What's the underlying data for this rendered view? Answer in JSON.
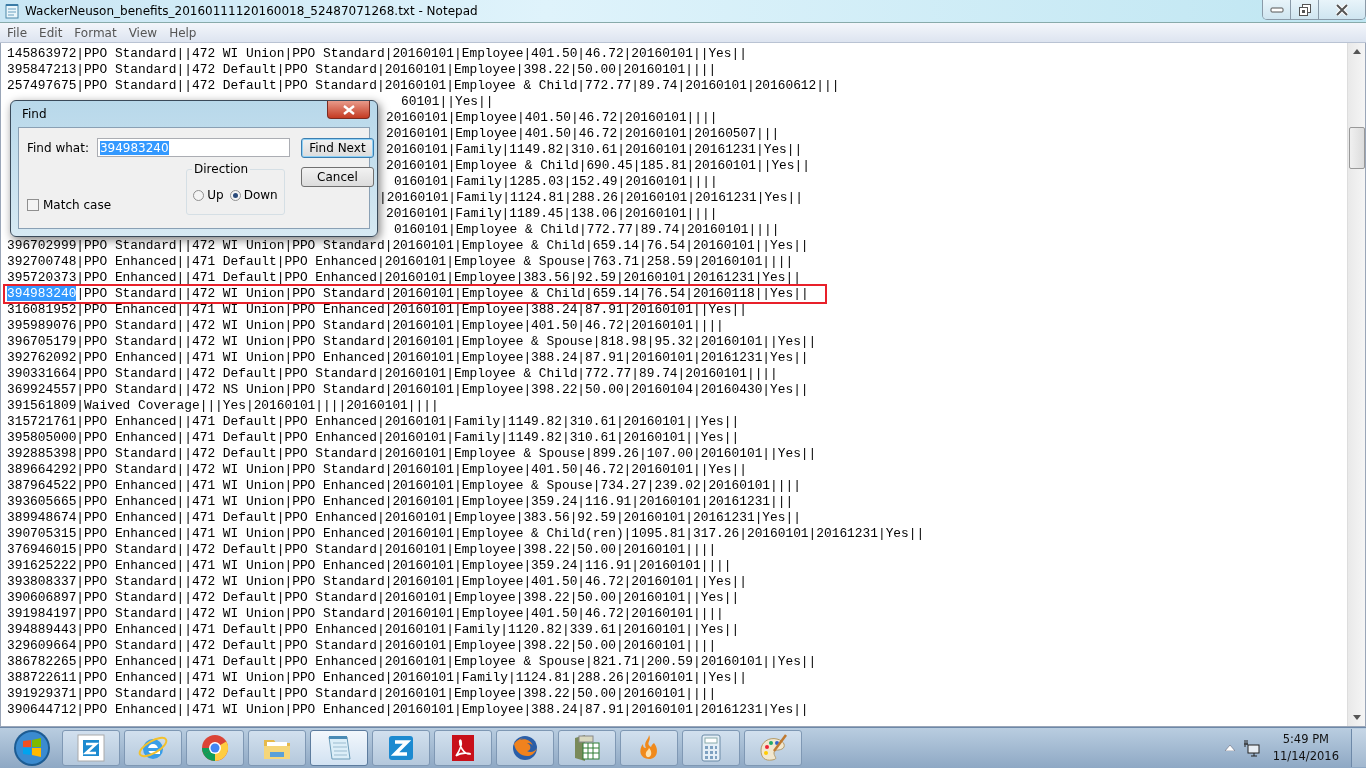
{
  "window": {
    "title": "WackerNeuson_benefits_20160111120160018_52487071268.txt - Notepad"
  },
  "menu": [
    "File",
    "Edit",
    "Format",
    "View",
    "Help"
  ],
  "lines": [
    {
      "kind": "plain",
      "text": "145863972|PPO Standard||472 WI Union|PPO Standard|20160101|Employee|401.50|46.72|20160101||Yes||"
    },
    {
      "kind": "plain",
      "text": "395847213|PPO Standard||472 Default|PPO Standard|20160101|Employee|398.22|50.00|20160101||||"
    },
    {
      "kind": "plain",
      "text": "257497675|PPO Standard||472 Default|PPO Standard|20160101|Employee & Child|772.77|89.74|20160101|20160612|||"
    },
    {
      "kind": "covered",
      "text": "60101||Yes||"
    },
    {
      "kind": "covered",
      "text": "20160101|Employee|401.50|46.72|20160101||||"
    },
    {
      "kind": "covered",
      "text": "20160101|Employee|401.50|46.72|20160101|20160507|||"
    },
    {
      "kind": "covered",
      "text": "20160101|Family|1149.82|310.61|20160101|20161231|Yes||"
    },
    {
      "kind": "covered",
      "text": "20160101|Employee & Child|690.45|185.81|20160101||Yes||"
    },
    {
      "kind": "covered",
      "text": "0160101|Family|1285.03|152.49|20160101||||"
    },
    {
      "kind": "covered",
      "text": "|20160101|Family|1124.81|288.26|20160101|20161231|Yes||"
    },
    {
      "kind": "covered",
      "text": "20160101|Family|1189.45|138.06|20160101||||"
    },
    {
      "kind": "covered",
      "text": "0160101|Employee & Child|772.77|89.74|20160101||||"
    },
    {
      "kind": "plain",
      "text": "396702999|PPO Standard||472 WI Union|PPO Standard|20160101|Employee & Child|659.14|76.54|20160101||Yes||"
    },
    {
      "kind": "plain",
      "text": "392700748|PPO Enhanced||471 Default|PPO Enhanced|20160101|Employee & Spouse|763.71|258.59|20160101||||"
    },
    {
      "kind": "plain",
      "text": "395720373|PPO Enhanced||471 Default|PPO Enhanced|20160101|Employee|383.56|92.59|20160101|20161231|Yes||"
    },
    {
      "kind": "selected",
      "selection": "394983240",
      "text": "|PPO Standard||472 WI Union|PPO Standard|20160101|Employee & Child|659.14|76.54|20160118||Yes||"
    },
    {
      "kind": "plain",
      "text": "316081952|PPO Enhanced||471 WI Union|PPO Enhanced|20160101|Employee|388.24|87.91|20160101||Yes||"
    },
    {
      "kind": "plain",
      "text": "395989076|PPO Standard||472 WI Union|PPO Standard|20160101|Employee|401.50|46.72|20160101||||"
    },
    {
      "kind": "plain",
      "text": "396705179|PPO Standard||472 WI Union|PPO Standard|20160101|Employee & Spouse|818.98|95.32|20160101||Yes||"
    },
    {
      "kind": "plain",
      "text": "392762092|PPO Enhanced||471 WI Union|PPO Enhanced|20160101|Employee|388.24|87.91|20160101|20161231|Yes||"
    },
    {
      "kind": "plain",
      "text": "390331664|PPO Standard||472 Default|PPO Standard|20160101|Employee & Child|772.77|89.74|20160101||||"
    },
    {
      "kind": "plain",
      "text": "369924557|PPO Standard||472 NS Union|PPO Standard|20160101|Employee|398.22|50.00|20160104|20160430|Yes||"
    },
    {
      "kind": "plain",
      "text": "391561809|Waived Coverage|||Yes|20160101||||20160101||||"
    },
    {
      "kind": "plain",
      "text": "315721761|PPO Enhanced||471 Default|PPO Enhanced|20160101|Family|1149.82|310.61|20160101||Yes||"
    },
    {
      "kind": "plain",
      "text": "395805000|PPO Enhanced||471 Default|PPO Enhanced|20160101|Family|1149.82|310.61|20160101||Yes||"
    },
    {
      "kind": "plain",
      "text": "392885398|PPO Standard||472 Default|PPO Standard|20160101|Employee & Spouse|899.26|107.00|20160101||Yes||"
    },
    {
      "kind": "plain",
      "text": "389664292|PPO Standard||472 WI Union|PPO Standard|20160101|Employee|401.50|46.72|20160101||Yes||"
    },
    {
      "kind": "plain",
      "text": "387964522|PPO Enhanced||471 WI Union|PPO Enhanced|20160101|Employee & Spouse|734.27|239.02|20160101||||"
    },
    {
      "kind": "plain",
      "text": "393605665|PPO Enhanced||471 WI Union|PPO Enhanced|20160101|Employee|359.24|116.91|20160101|20161231|||"
    },
    {
      "kind": "plain",
      "text": "389948674|PPO Enhanced||471 Default|PPO Enhanced|20160101|Employee|383.56|92.59|20160101|20161231|Yes||"
    },
    {
      "kind": "plain",
      "text": "390705315|PPO Enhanced||471 WI Union|PPO Enhanced|20160101|Employee & Child(ren)|1095.81|317.26|20160101|20161231|Yes||"
    },
    {
      "kind": "plain",
      "text": "376946015|PPO Standard||472 Default|PPO Standard|20160101|Employee|398.22|50.00|20160101||||"
    },
    {
      "kind": "plain",
      "text": "391625222|PPO Enhanced||471 WI Union|PPO Enhanced|20160101|Employee|359.24|116.91|20160101||||"
    },
    {
      "kind": "plain",
      "text": "393808337|PPO Standard||472 WI Union|PPO Standard|20160101|Employee|401.50|46.72|20160101||Yes||"
    },
    {
      "kind": "plain",
      "text": "390606897|PPO Standard||472 Default|PPO Standard|20160101|Employee|398.22|50.00|20160101||Yes||"
    },
    {
      "kind": "plain",
      "text": "391984197|PPO Standard||472 WI Union|PPO Standard|20160101|Employee|401.50|46.72|20160101||||"
    },
    {
      "kind": "plain",
      "text": "394889443|PPO Enhanced||471 Default|PPO Enhanced|20160101|Family|1120.82|339.61|20160101||Yes||"
    },
    {
      "kind": "plain",
      "text": "329609664|PPO Standard||472 Default|PPO Standard|20160101|Employee|398.22|50.00|20160101||||"
    },
    {
      "kind": "plain",
      "text": "386782265|PPO Enhanced||471 Default|PPO Enhanced|20160101|Employee & Spouse|821.71|200.59|20160101||Yes||"
    },
    {
      "kind": "plain",
      "text": "388722611|PPO Enhanced||471 WI Union|PPO Enhanced|20160101|Family|1124.81|288.26|20160101||Yes||"
    },
    {
      "kind": "plain",
      "text": "391929371|PPO Standard||472 Default|PPO Standard|20160101|Employee|398.22|50.00|20160101||||"
    },
    {
      "kind": "plain",
      "text": "390644712|PPO Enhanced||471 WI Union|PPO Enhanced|20160101|Employee|388.24|87.91|20160101|20161231|Yes||"
    }
  ],
  "find_dialog": {
    "title": "Find",
    "find_what_label": "Find what:",
    "find_what_value": "394983240",
    "find_next": "Find Next",
    "cancel": "Cancel",
    "direction_label": "Direction",
    "directions": [
      {
        "label": "Up",
        "selected": false
      },
      {
        "label": "Down",
        "selected": true
      }
    ],
    "match_case": {
      "label": "Match case",
      "checked": false
    }
  },
  "taskbar": {
    "apps": [
      {
        "kind": "z-app",
        "active": false
      },
      {
        "kind": "ie",
        "active": false
      },
      {
        "kind": "chrome",
        "active": false
      },
      {
        "kind": "folder",
        "active": false
      },
      {
        "kind": "notepad",
        "active": true
      },
      {
        "kind": "z-blue",
        "active": false
      },
      {
        "kind": "pdf",
        "active": false
      },
      {
        "kind": "firefox",
        "active": false
      },
      {
        "kind": "spreadsheet",
        "active": false
      },
      {
        "kind": "flame",
        "active": false
      },
      {
        "kind": "calculator",
        "active": false
      },
      {
        "kind": "paint",
        "active": false
      }
    ],
    "time": "5:49 PM",
    "date": "11/14/2016"
  }
}
